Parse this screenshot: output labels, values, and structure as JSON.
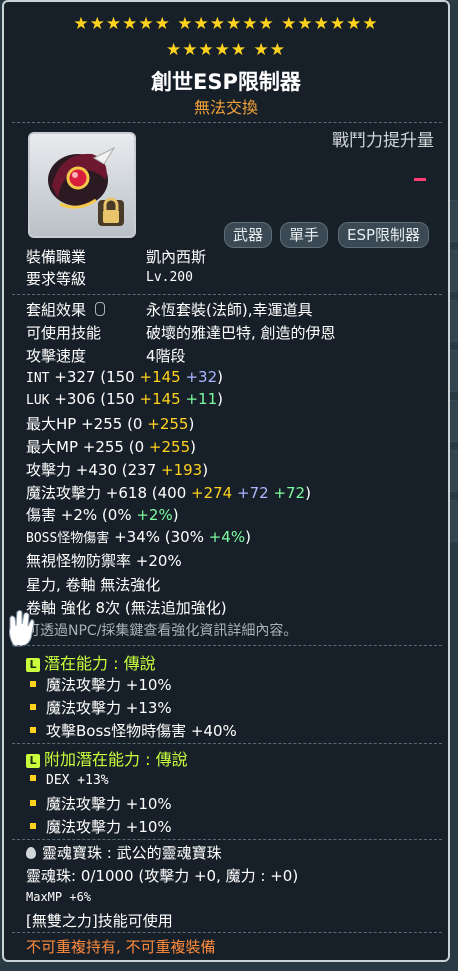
{
  "stars": {
    "row1": "★★★★★★ ★★★★★★ ★★★★★★",
    "row2": "★★★★★ ★★"
  },
  "item": {
    "name": "創世ESP限制器",
    "trade": "無法交換"
  },
  "power": {
    "label": "戰鬥力提升量"
  },
  "tags": [
    "武器",
    "單手",
    "ESP限制器"
  ],
  "req": {
    "job_label": "裝備職業",
    "job_value": "凱內西斯",
    "level_label": "要求等級",
    "level_value": "Lv.200"
  },
  "info": {
    "set_label": "套組效果",
    "set_value": "永恆套裝(法師),幸運道具",
    "skill_label": "可使用技能",
    "skill_value": "破壞的雅達巴特, 創造的伊恩",
    "speed_label": "攻擊速度",
    "speed_value": "4階段"
  },
  "stats": [
    {
      "name": "INT",
      "total": "+327",
      "base": "(150 ",
      "b1": "+145",
      "b2": " +32",
      "c2": "blue",
      "end": ")"
    },
    {
      "name": "LUK",
      "total": "+306",
      "base": "(150 ",
      "b1": "+145",
      "b2": " +11",
      "c2": "green",
      "end": ")"
    },
    {
      "name": "最大HP",
      "total": "+255",
      "base": "(0 ",
      "b1": "+255",
      "b2": "",
      "c2": "blue",
      "end": ")"
    },
    {
      "name": "最大MP",
      "total": "+255",
      "base": "(0 ",
      "b1": "+255",
      "b2": "",
      "c2": "blue",
      "end": ")"
    },
    {
      "name": "攻擊力",
      "total": "+430",
      "base": "(237 ",
      "b1": "+193",
      "b2": "",
      "c2": "blue",
      "end": ")"
    },
    {
      "name": "魔法攻擊力",
      "total": "+618",
      "base": "(400 ",
      "b1": "+274",
      "b2": " +72",
      "c2": "blue",
      "b3": " +72",
      "c3": "green",
      "end": ")"
    },
    {
      "name": "傷害",
      "total": "+2%",
      "base": "(0% ",
      "b1": "",
      "b2": "+2%",
      "c2": "green",
      "end": ")"
    },
    {
      "name": "BOSS怪物傷害",
      "total": "+34%",
      "base": "(30% ",
      "b1": "",
      "b2": "+4%",
      "c2": "green",
      "end": ")"
    },
    {
      "name": "無視怪物防禦率",
      "total": "+20%",
      "base": "",
      "b1": "",
      "b2": "",
      "c2": "blue",
      "end": ""
    }
  ],
  "enhance": {
    "line1": "星力, 卷軸 無法強化",
    "line2": "卷軸 強化 8次 (無法追加強化)",
    "line3": "可透過NPC/採集鍵查看強化資訊詳細內容。"
  },
  "potential": {
    "badge": "L",
    "title": "潛在能力 : 傳說",
    "lines": [
      "魔法攻擊力 +10%",
      "魔法攻擊力 +13%",
      "攻擊Boss怪物時傷害 +40%"
    ]
  },
  "additional": {
    "badge": "L",
    "title": "附加潛在能力 : 傳說",
    "lines": [
      "DEX +13%",
      "魔法攻擊力 +10%",
      "魔法攻擊力 +10%"
    ]
  },
  "soul": {
    "title": "靈魂寶珠 : 武公的靈魂寶珠",
    "line": "靈魂珠: 0/1000 (攻擊力 +0, 魔力 : +0)",
    "mp": "MaxMP +6%"
  },
  "footer": {
    "skill": "[無雙之力]技能可使用",
    "unique": "不可重複持有, 不可重複裝備"
  }
}
